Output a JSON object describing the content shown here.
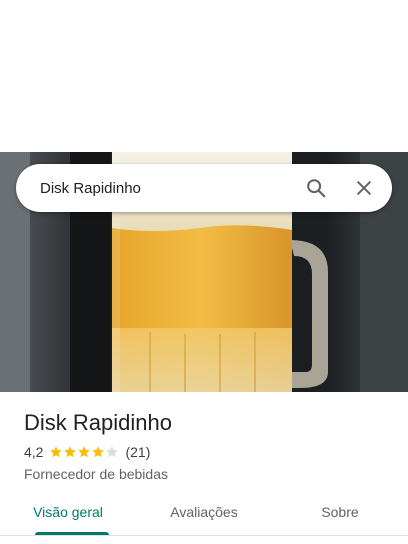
{
  "search": {
    "query": "Disk Rapidinho",
    "search_icon": "search-icon",
    "close_icon": "close-icon"
  },
  "place": {
    "name": "Disk Rapidinho",
    "rating": "4,2",
    "rating_fraction": 0.84,
    "review_count": "(21)",
    "category": "Fornecedor de bebidas"
  },
  "tabs": [
    {
      "label": "Visão geral",
      "active": true
    },
    {
      "label": "Avaliações",
      "active": false
    },
    {
      "label": "Sobre",
      "active": false
    }
  ],
  "colors": {
    "accent": "#00796b",
    "star": "#fbbc04",
    "star_empty": "#dadce0"
  }
}
